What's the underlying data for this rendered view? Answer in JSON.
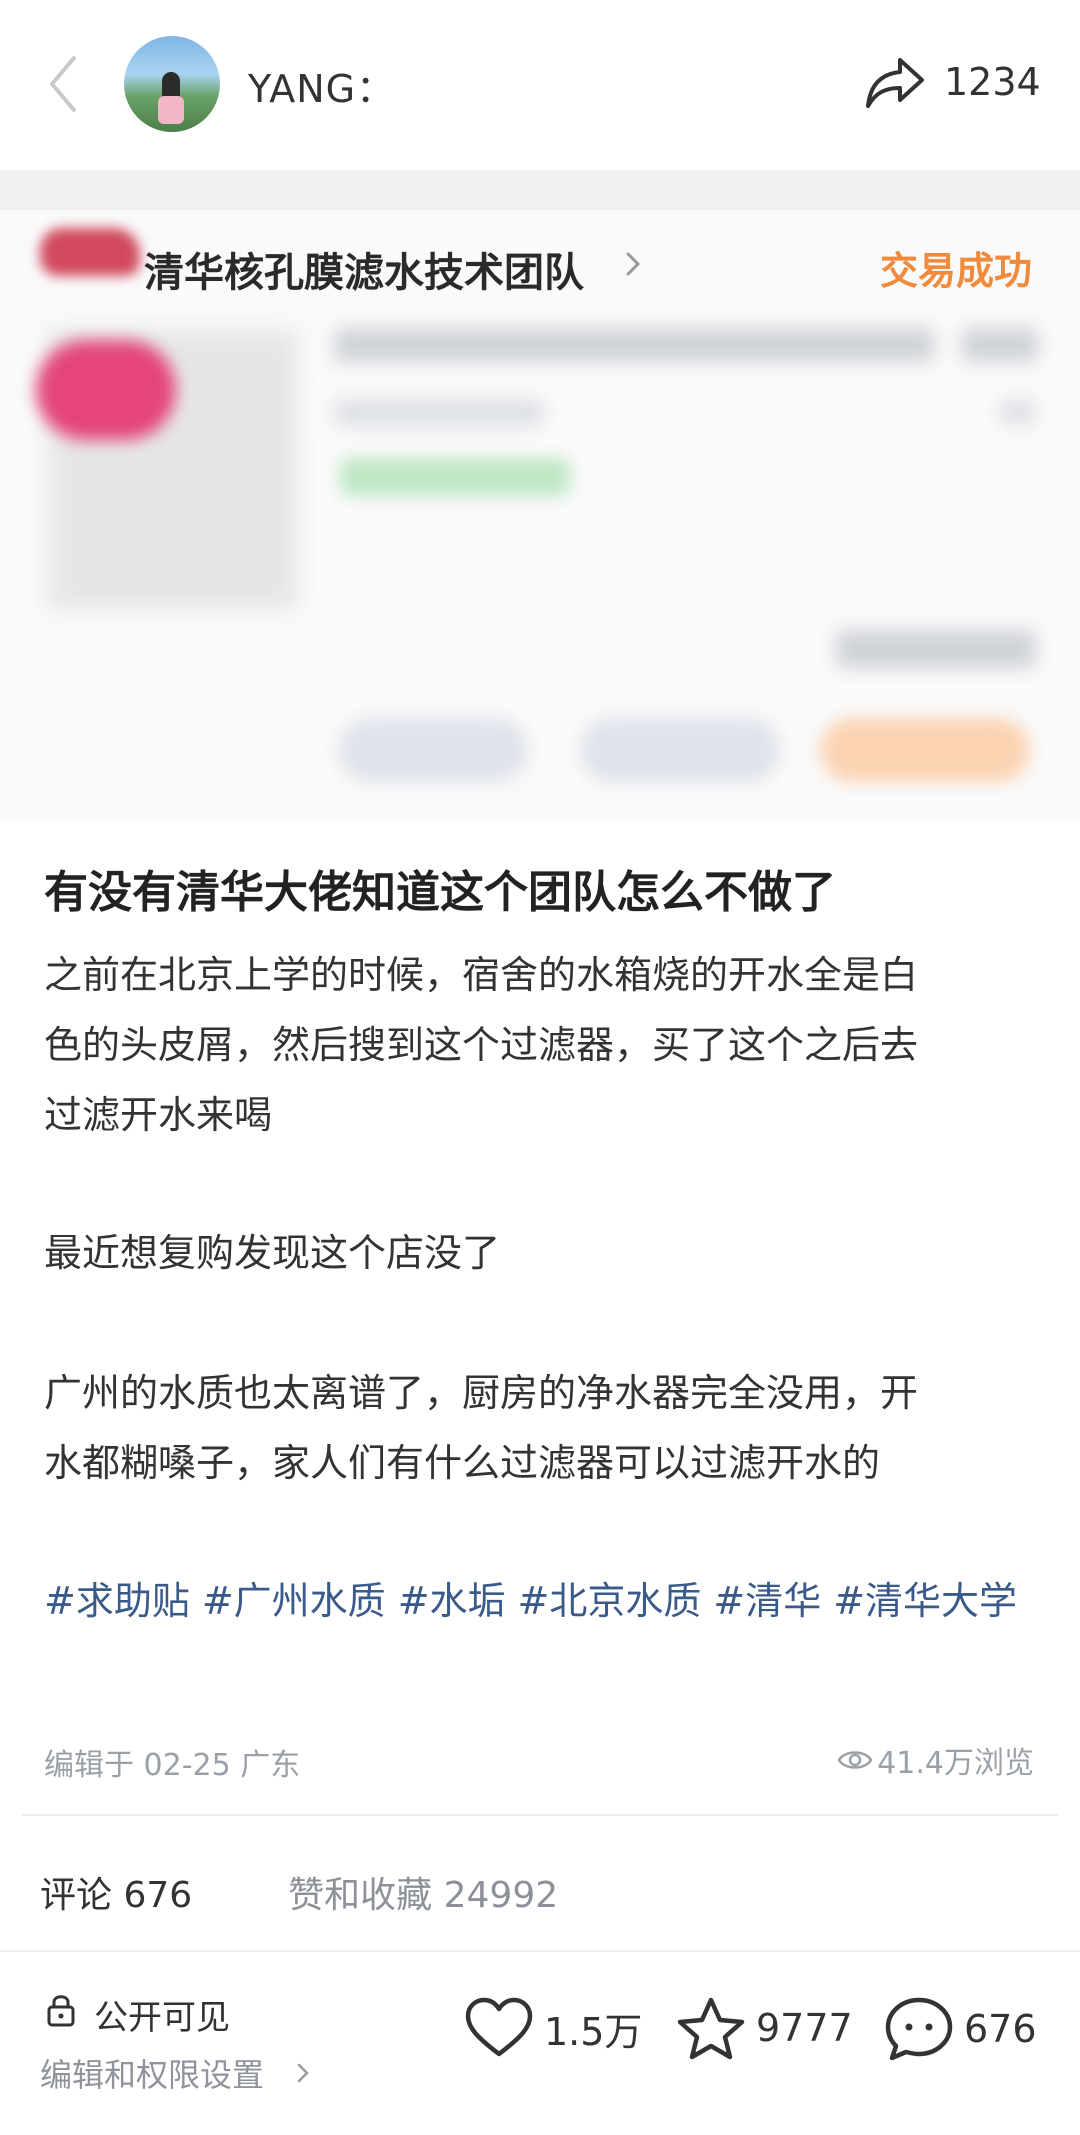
{
  "header": {
    "username": "YANG：",
    "share_count": "1234"
  },
  "order_card": {
    "shop_name": "清华核孔膜滤水技术团队",
    "status": "交易成功"
  },
  "post": {
    "title": "有没有清华大佬知道这个团队怎么不做了",
    "paragraphs": [
      "之前在北京上学的时候，宿舍的水箱烧的开水全是白\n色的头皮屑，然后搜到这个过滤器，买了这个之后去\n过滤开水来喝",
      "最近想复购发现这个店没了",
      "广州的水质也太离谱了，厨房的净水器完全没用，开\n水都糊嗓子，家人们有什么过滤器可以过滤开水的"
    ],
    "tags": [
      "#求助贴",
      "#广州水质",
      "#水垢",
      "#北京水质",
      "#清华",
      "#清华大学"
    ],
    "edited": "编辑于 02-25 广东",
    "views": "41.4万浏览"
  },
  "stats": {
    "comments_label": "评论 676",
    "likes_label": "赞和收藏 24992"
  },
  "bottom_bar": {
    "visibility": "公开可见",
    "permission": "编辑和权限设置",
    "likes": "1.5万",
    "collects": "9777",
    "comments": "676"
  },
  "colors": {
    "accent_orange": "#f08a3c",
    "tag_blue": "#3a5a8a"
  }
}
